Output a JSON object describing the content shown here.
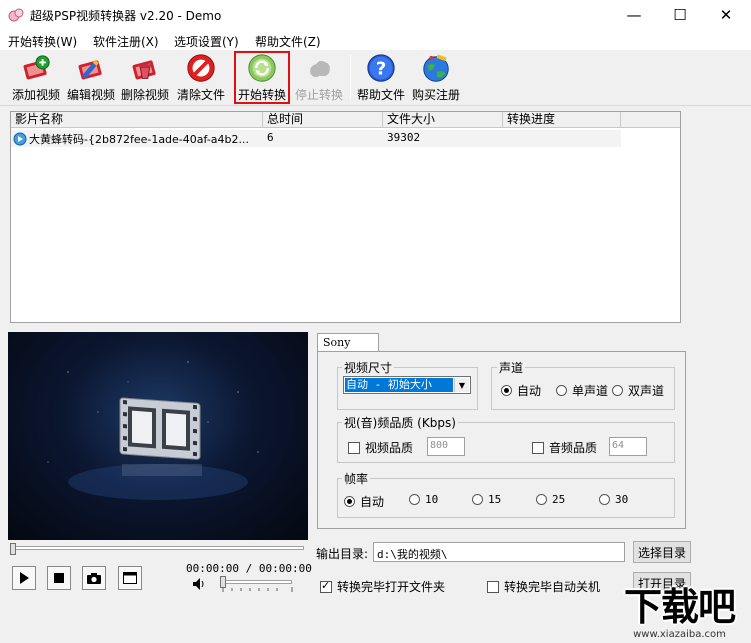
{
  "window": {
    "title": "超级PSP视频转换器 v2.20 - Demo",
    "minimize_glyph": "—",
    "maximize_glyph": "☐",
    "close_glyph": "✕"
  },
  "menu": {
    "items": [
      {
        "label": "开始转换(W)"
      },
      {
        "label": "软件注册(X)"
      },
      {
        "label": "选项设置(Y)"
      },
      {
        "label": "帮助文件(Z)"
      }
    ]
  },
  "toolbar": {
    "buttons": [
      {
        "label": "添加视频",
        "icon": "add-video-icon",
        "enabled": true
      },
      {
        "label": "编辑视频",
        "icon": "edit-video-icon",
        "enabled": true
      },
      {
        "label": "删除视频",
        "icon": "delete-video-icon",
        "enabled": true
      },
      {
        "label": "清除文件",
        "icon": "clear-files-icon",
        "enabled": true
      },
      {
        "label": "开始转换",
        "icon": "start-convert-icon",
        "enabled": true
      },
      {
        "label": "停止转换",
        "icon": "stop-convert-icon",
        "enabled": false
      },
      {
        "label": "帮助文件",
        "icon": "help-icon",
        "enabled": true
      },
      {
        "label": "购买注册",
        "icon": "buy-register-icon",
        "enabled": true
      }
    ]
  },
  "file_list": {
    "columns": [
      "影片名称",
      "总时间",
      "文件大小",
      "转换进度"
    ],
    "rows": [
      {
        "name": "大黄蜂转码-{2b872fee-1ade-40af-a4b2...",
        "duration": "6",
        "size": "39302",
        "progress": ""
      }
    ]
  },
  "player": {
    "time": "00:00:00 / 00:00:00",
    "position_fraction": 0,
    "volume_fraction": 0
  },
  "settings": {
    "tab_label": "Sony PSP",
    "video_size": {
      "title": "视频尺寸",
      "selected": "自动 - 初始大小"
    },
    "audio_channel": {
      "title": "声道",
      "options": [
        {
          "label": "自动",
          "selected": true
        },
        {
          "label": "单声道",
          "selected": false
        },
        {
          "label": "双声道",
          "selected": false
        }
      ]
    },
    "quality": {
      "title": "视(音)频品质 (Kbps)",
      "video_label": "视频品质",
      "video_checked": false,
      "video_value": "800",
      "audio_label": "音频品质",
      "audio_checked": false,
      "audio_value": "64"
    },
    "frame_rate": {
      "title": "帧率",
      "options": [
        {
          "label": "自动",
          "selected": true
        },
        {
          "label": "10",
          "selected": false
        },
        {
          "label": "15",
          "selected": false
        },
        {
          "label": "25",
          "selected": false
        },
        {
          "label": "30",
          "selected": false
        }
      ]
    }
  },
  "output": {
    "label": "输出目录:",
    "path": "d:\\我的视频\\",
    "choose_button": "选择目录",
    "open_button": "打开目录"
  },
  "options": {
    "open_folder_label": "转换完毕打开文件夹",
    "open_folder_checked": true,
    "shutdown_label": "转换完毕自动关机",
    "shutdown_checked": false
  },
  "watermark": {
    "main": "下载吧",
    "sub": "www.xiazaiba.com"
  }
}
